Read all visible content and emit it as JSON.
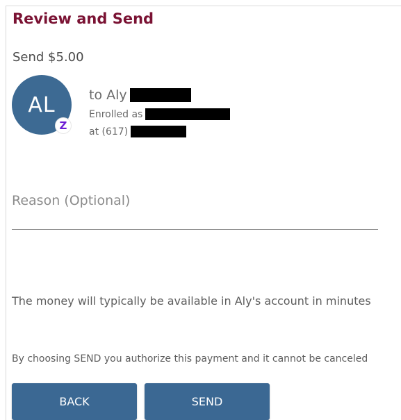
{
  "header": {
    "title": "Review and Send"
  },
  "payment": {
    "send_label": "Send $5.00"
  },
  "recipient": {
    "avatar_initials": "AL",
    "badge_icon": "zelle-icon",
    "badge_glyph": "Z",
    "to_text": "to Aly",
    "enrolled_text": "Enrolled as",
    "phone_prefix": "at (617)"
  },
  "reason": {
    "placeholder": "Reason (Optional)",
    "value": ""
  },
  "messages": {
    "availability": "The money will typically be available in Aly's account in minutes",
    "authorize": "By choosing SEND you authorize this payment and it cannot be canceled"
  },
  "actions": {
    "back_label": "BACK",
    "send_label": "SEND"
  },
  "colors": {
    "title": "#7a1233",
    "avatar": "#3d6a93",
    "button": "#3b6893",
    "badge": "#6d1ed4"
  }
}
